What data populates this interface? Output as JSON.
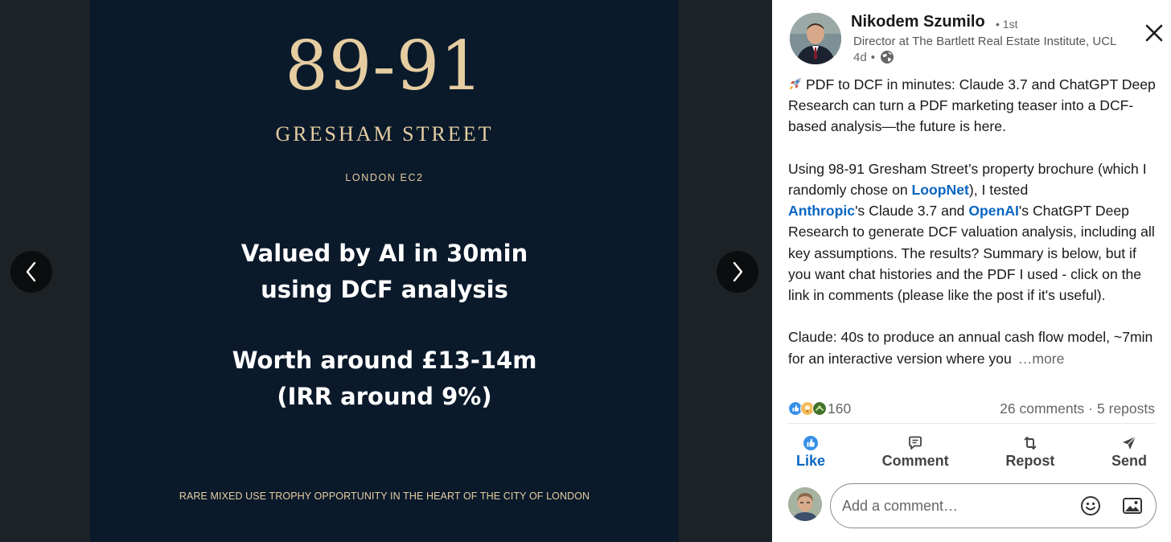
{
  "slide": {
    "number": "89-91",
    "street": "GRESHAM STREET",
    "city": "LONDON EC2",
    "headline_1": "Valued by AI in 30min",
    "headline_2": "using DCF analysis",
    "worth_1": "Worth around £13-14m",
    "worth_2": "(IRR around 9%)",
    "footer": "RARE MIXED USE TROPHY OPPORTUNITY IN THE HEART OF THE CITY OF LONDON"
  },
  "author": {
    "name": "Nikodem Szumilo",
    "degree": "• 1st",
    "title": "Director at The Bartlett Real Estate Institute, UCL",
    "time": "4d",
    "time_sep": "•"
  },
  "post": {
    "p1": "PDF to DCF in minutes: Claude 3.7 and ChatGPT Deep Research can turn a PDF marketing teaser into a DCF-based analysis—the future is here.",
    "p2_a": "Using 98-91 Gresham Street’s property brochure (which I randomly chose on ",
    "mention_loopnet": "LoopNet",
    "p2_b": "), I tested ",
    "mention_anthropic": "Anthropic",
    "p2_c": "'s Claude 3.7 and ",
    "mention_openai": "OpenAI",
    "p2_d": "'s ChatGPT Deep Research to generate DCF valuation analysis, including all key assumptions. The results? Summary is below, but if you want chat histories and the PDF I used - click on the link in comments (please like the post if it's useful).",
    "p3": "Claude: 40s to produce an annual cash flow model, ~7min for an interactive version where you",
    "more": "…more"
  },
  "social": {
    "reactions_count": "160",
    "comments": "26 comments",
    "sep": "·",
    "reposts": "5 reposts"
  },
  "actions": {
    "like": "Like",
    "comment": "Comment",
    "repost": "Repost",
    "send": "Send"
  },
  "comment_box": {
    "placeholder": "Add a comment…"
  },
  "colors": {
    "accent": "#0a66c2",
    "slide_bg": "#0b1a2b",
    "slide_gold": "#e5cda1"
  },
  "icons": [
    "chevron-left-icon",
    "chevron-right-icon",
    "close-icon",
    "globe-icon",
    "rocket-icon",
    "like-icon",
    "comment-icon",
    "repost-icon",
    "send-icon",
    "emoji-icon",
    "image-icon"
  ]
}
